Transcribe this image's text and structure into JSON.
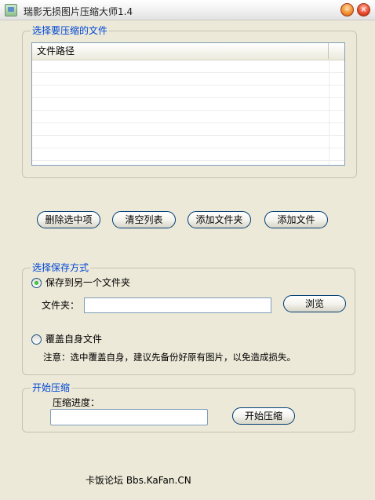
{
  "window": {
    "title": "瑞影无损图片压缩大师1.4",
    "min_glyph": "–",
    "close_glyph": "×"
  },
  "file_group": {
    "legend": "选择要压缩的文件",
    "column_header": "文件路径",
    "rows": []
  },
  "actions": {
    "delete_selected": "删除选中项",
    "clear_list": "清空列表",
    "add_folder": "添加文件夹",
    "add_file": "添加文件"
  },
  "save_group": {
    "legend": "选择保存方式",
    "option_other_folder": "保存到另一个文件夹",
    "folder_label": "文件夹：",
    "folder_value": "",
    "browse": "浏览",
    "option_overwrite": "覆盖自身文件",
    "note": "注意：选中覆盖自身，建议先备份好原有图片，以免造成损失。",
    "selected": "other_folder"
  },
  "start_group": {
    "legend": "开始压缩",
    "progress_label": "压缩进度：",
    "progress_value": 0,
    "start_button": "开始压缩"
  },
  "footer": {
    "text": "卡饭论坛 Bbs.KaFan.CN"
  },
  "colors": {
    "legend_blue": "#0046d5",
    "window_bg": "#ece9d8",
    "button_border": "#003c74"
  }
}
